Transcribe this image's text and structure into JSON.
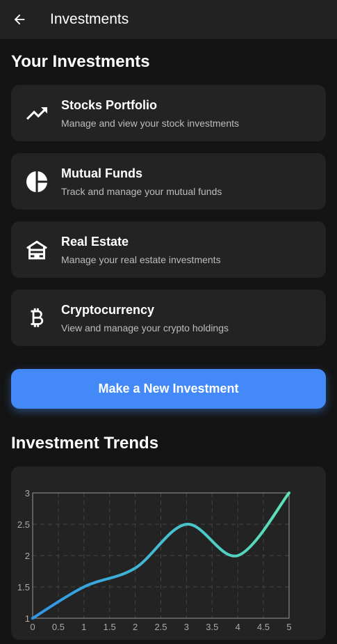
{
  "appbar": {
    "title": "Investments",
    "back_icon": "arrow-back-icon"
  },
  "investments": {
    "title": "Your Investments",
    "items": [
      {
        "title": "Stocks Portfolio",
        "subtitle": "Manage and view your stock investments",
        "icon": "trending-up-icon"
      },
      {
        "title": "Mutual Funds",
        "subtitle": "Track and manage your mutual funds",
        "icon": "pie-chart-icon"
      },
      {
        "title": "Real Estate",
        "subtitle": "Manage your real estate investments",
        "icon": "house-icon"
      },
      {
        "title": "Cryptocurrency",
        "subtitle": "View and manage your crypto holdings",
        "icon": "bitcoin-icon"
      }
    ]
  },
  "cta": {
    "label": "Make a New Investment",
    "color": "#4489f8"
  },
  "trends": {
    "title": "Investment Trends"
  },
  "chart_data": {
    "type": "line",
    "x": [
      0,
      1,
      2,
      3,
      4,
      5
    ],
    "series": [
      {
        "values": [
          1,
          1.5,
          1.8,
          2.5,
          2.0,
          3.0
        ]
      }
    ],
    "xlim": [
      0,
      5
    ],
    "ylim": [
      1,
      3
    ],
    "xticks": [
      "0",
      "0.5",
      "1",
      "1.5",
      "2",
      "2.5",
      "3",
      "3.5",
      "4",
      "4.5",
      "5"
    ],
    "yticks": [
      "1",
      "1.5",
      "2",
      "2.5",
      "3"
    ],
    "grid": true,
    "line_gradient": [
      "#2f95e8",
      "#5ce3b8"
    ]
  }
}
